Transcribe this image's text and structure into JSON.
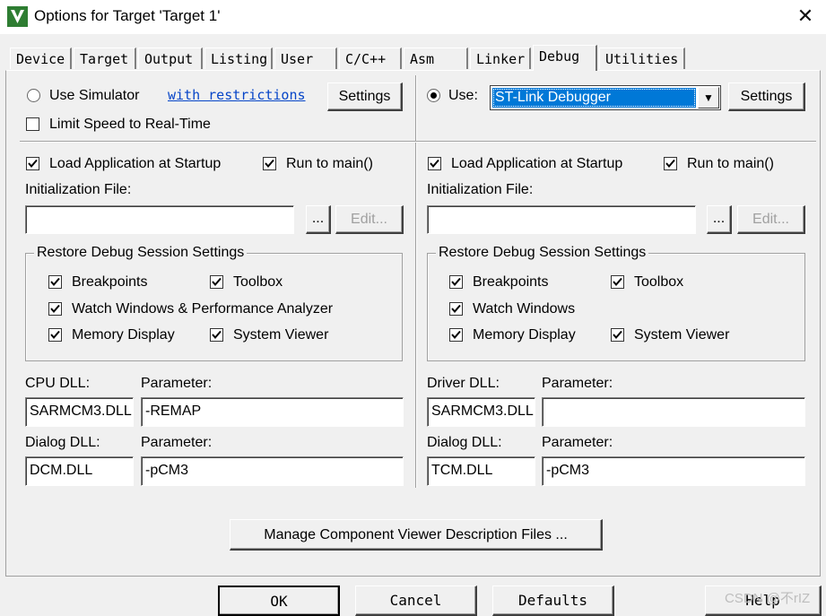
{
  "window": {
    "title": "Options for Target 'Target 1'",
    "close": "✕"
  },
  "tabs": [
    {
      "label": "Device"
    },
    {
      "label": "Target"
    },
    {
      "label": "Output"
    },
    {
      "label": "Listing"
    },
    {
      "label": "User"
    },
    {
      "label": "C/C++"
    },
    {
      "label": "Asm"
    },
    {
      "label": "Linker"
    },
    {
      "label": "Debug",
      "active": true
    },
    {
      "label": "Utilities"
    }
  ],
  "left": {
    "use_simulator": "Use Simulator",
    "use_simulator_selected": false,
    "restrictions_link": "with restrictions",
    "settings": "Settings",
    "limit_speed": "Limit Speed to Real-Time",
    "limit_speed_checked": false,
    "load_app": "Load Application at Startup",
    "run_to_main": "Run to main()",
    "init_file_label": "Initialization File:",
    "init_file_value": "",
    "browse": "...",
    "edit": "Edit...",
    "restore_group": "Restore Debug Session Settings",
    "breakpoints": "Breakpoints",
    "toolbox": "Toolbox",
    "watch_windows": "Watch Windows & Performance Analyzer",
    "memory_display": "Memory Display",
    "system_viewer": "System Viewer",
    "dll_label": "CPU DLL:",
    "dll_param_label": "Parameter:",
    "dll_value": "SARMCM3.DLL",
    "dll_param_value": "-REMAP",
    "dialog_dll_label": "Dialog DLL:",
    "dialog_param_label": "Parameter:",
    "dialog_dll_value": "DCM.DLL",
    "dialog_param_value": "-pCM3"
  },
  "right": {
    "use_label": "Use:",
    "use_selected": true,
    "debugger": "ST-Link Debugger",
    "settings": "Settings",
    "load_app": "Load Application at Startup",
    "run_to_main": "Run to main()",
    "init_file_label": "Initialization File:",
    "init_file_value": "",
    "browse": "...",
    "edit": "Edit...",
    "restore_group": "Restore Debug Session Settings",
    "breakpoints": "Breakpoints",
    "toolbox": "Toolbox",
    "watch_windows": "Watch Windows",
    "memory_display": "Memory Display",
    "system_viewer": "System Viewer",
    "dll_label": "Driver DLL:",
    "dll_param_label": "Parameter:",
    "dll_value": "SARMCM3.DLL",
    "dll_param_value": "",
    "dialog_dll_label": "Dialog DLL:",
    "dialog_param_label": "Parameter:",
    "dialog_dll_value": "TCM.DLL",
    "dialog_param_value": "-pCM3"
  },
  "manage_button": "Manage Component Viewer Description Files ...",
  "footer": {
    "ok": "OK",
    "cancel": "Cancel",
    "defaults": "Defaults",
    "help": "Help"
  },
  "watermark": "CSDN @不rIZ",
  "colors": {
    "face": "#f0f0f0",
    "selection": "#0078d7",
    "link": "#0645c8",
    "icon_green": "#2e7d32"
  }
}
